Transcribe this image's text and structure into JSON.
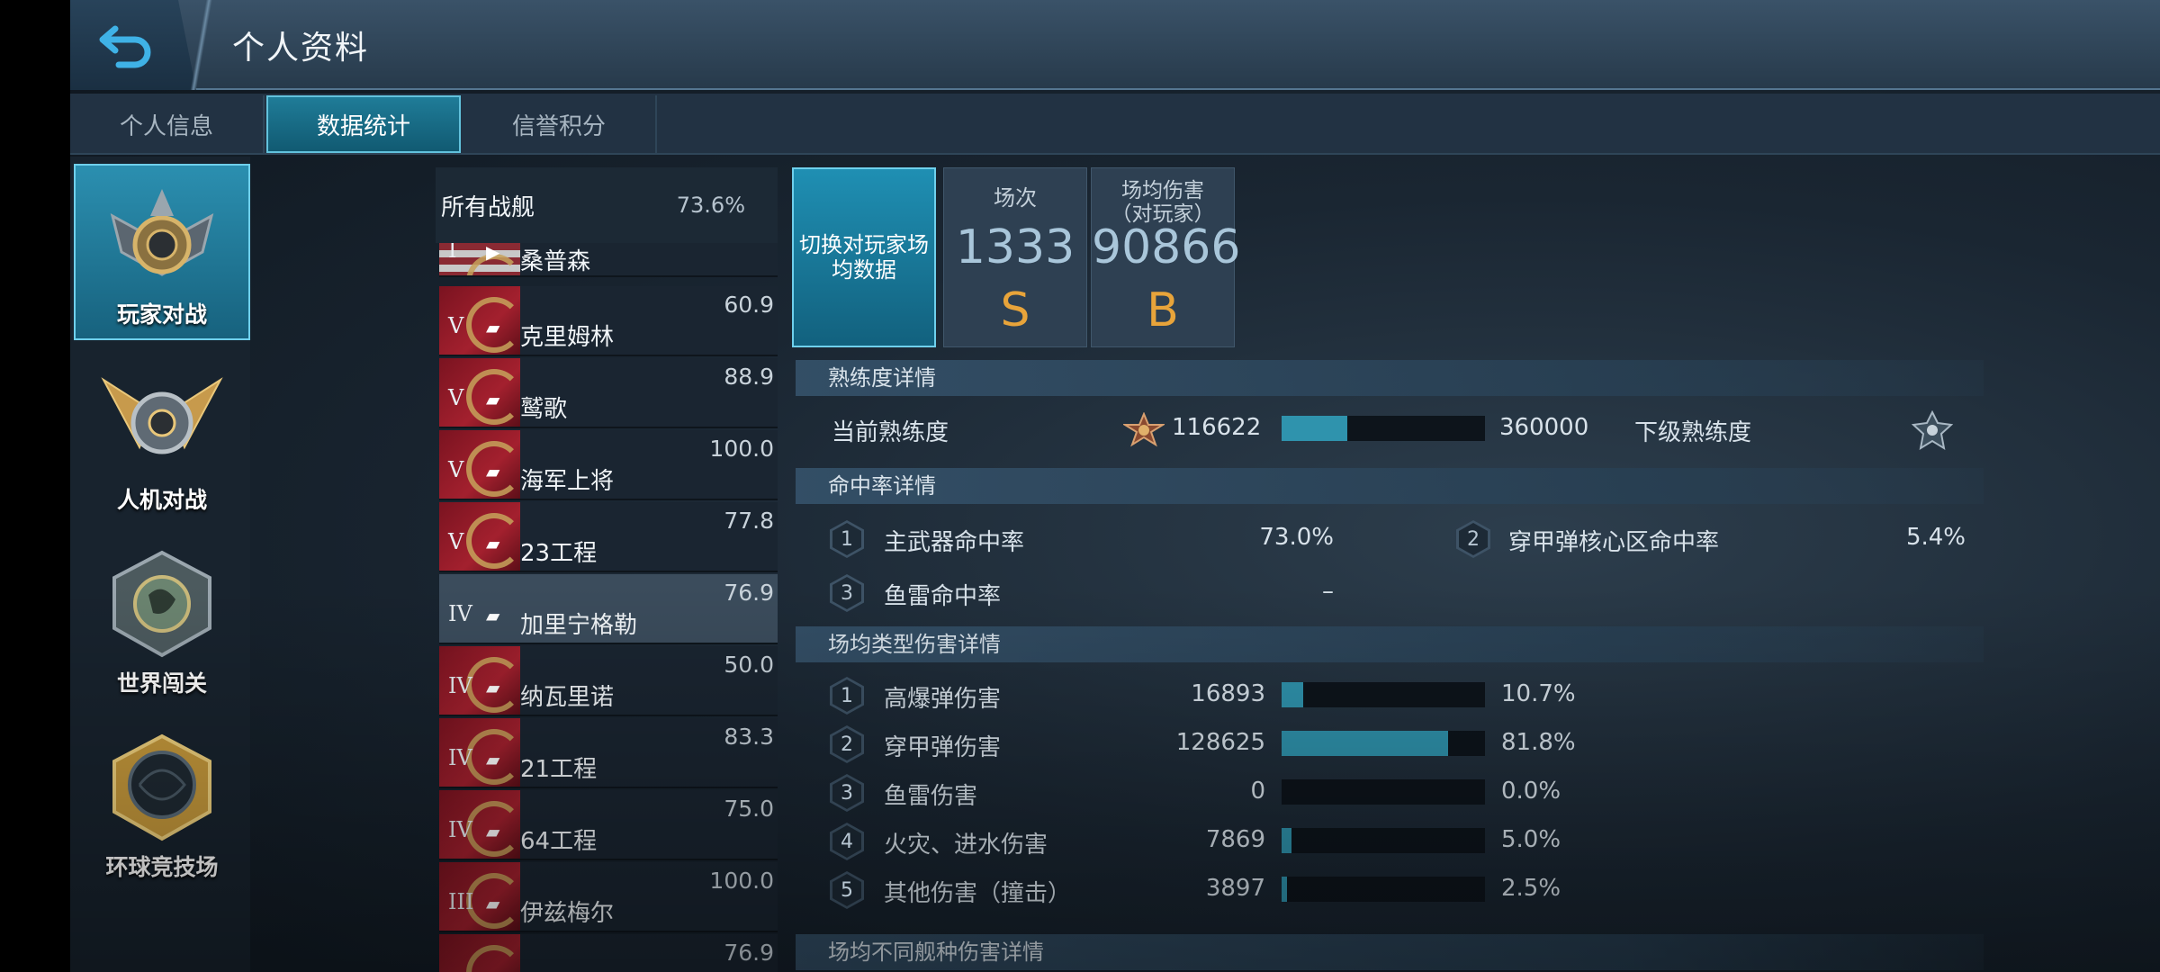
{
  "header": {
    "title": "个人资料"
  },
  "tabs": [
    {
      "label": "个人信息",
      "active": false
    },
    {
      "label": "数据统计",
      "active": true
    },
    {
      "label": "信誉积分",
      "active": false
    }
  ],
  "modes": [
    {
      "label": "玩家对战",
      "active": true,
      "icon": "pvp-emblem-icon"
    },
    {
      "label": "人机对战",
      "active": false,
      "icon": "pve-emblem-icon"
    },
    {
      "label": "世界闯关",
      "active": false,
      "icon": "world-emblem-icon"
    },
    {
      "label": "环球竞技场",
      "active": false,
      "icon": "arena-emblem-icon"
    }
  ],
  "ships_header": {
    "name": "所有战舰",
    "pct": "73.6%"
  },
  "ships": [
    {
      "tier": "I",
      "name": "桑普森",
      "score": ""
    },
    {
      "tier": "V",
      "name": "克里姆林",
      "score": "60.9"
    },
    {
      "tier": "V",
      "name": "鹫歌",
      "score": "88.9"
    },
    {
      "tier": "V",
      "name": "海军上将",
      "score": "100.0"
    },
    {
      "tier": "V",
      "name": "23工程",
      "score": "77.8"
    },
    {
      "tier": "IV",
      "name": "加里宁格勒",
      "score": "76.9"
    },
    {
      "tier": "IV",
      "name": "纳瓦里诺",
      "score": "50.0"
    },
    {
      "tier": "IV",
      "name": "21工程",
      "score": "83.3"
    },
    {
      "tier": "IV",
      "name": "64工程",
      "score": "75.0"
    },
    {
      "tier": "III",
      "name": "伊兹梅尔",
      "score": "100.0"
    },
    {
      "tier": "",
      "name": "",
      "score": "76.9"
    }
  ],
  "switch_button": "切换对玩家场均数据",
  "cards": {
    "matches": {
      "label": "场次",
      "value": "1333",
      "grade": "S"
    },
    "avg_damage": {
      "label": "场均伤害\n（对玩家）",
      "value": "90866",
      "grade": "B"
    }
  },
  "proficiency": {
    "title": "熟练度详情",
    "current_label": "当前熟练度",
    "current_value": "116622",
    "max_value": "360000",
    "progress": 0.324,
    "next_label": "下级熟练度"
  },
  "hit_rate": {
    "title": "命中率详情",
    "items": [
      {
        "index": "1",
        "label": "主武器命中率",
        "value": "73.0%"
      },
      {
        "index": "2",
        "label": "穿甲弹核心区命中率",
        "value": "5.4%"
      },
      {
        "index": "3",
        "label": "鱼雷命中率",
        "value": "–"
      }
    ]
  },
  "damage_types": {
    "title": "场均类型伤害详情",
    "items": [
      {
        "index": "1",
        "label": "高爆弹伤害",
        "value": "16893",
        "pct": "10.7%",
        "fraction": 0.107
      },
      {
        "index": "2",
        "label": "穿甲弹伤害",
        "value": "128625",
        "pct": "81.8%",
        "fraction": 0.818
      },
      {
        "index": "3",
        "label": "鱼雷伤害",
        "value": "0",
        "pct": "0.0%",
        "fraction": 0.0
      },
      {
        "index": "4",
        "label": "火灾、进水伤害",
        "value": "7869",
        "pct": "5.0%",
        "fraction": 0.05
      },
      {
        "index": "5",
        "label": "其他伤害（撞击）",
        "value": "3897",
        "pct": "2.5%",
        "fraction": 0.025
      }
    ]
  },
  "ship_type_damage": {
    "title": "场均不同舰种伤害详情"
  },
  "colors": {
    "accent": "#2f93ad",
    "grade": "#e8a43a",
    "active_tab": "#1f7c98"
  }
}
